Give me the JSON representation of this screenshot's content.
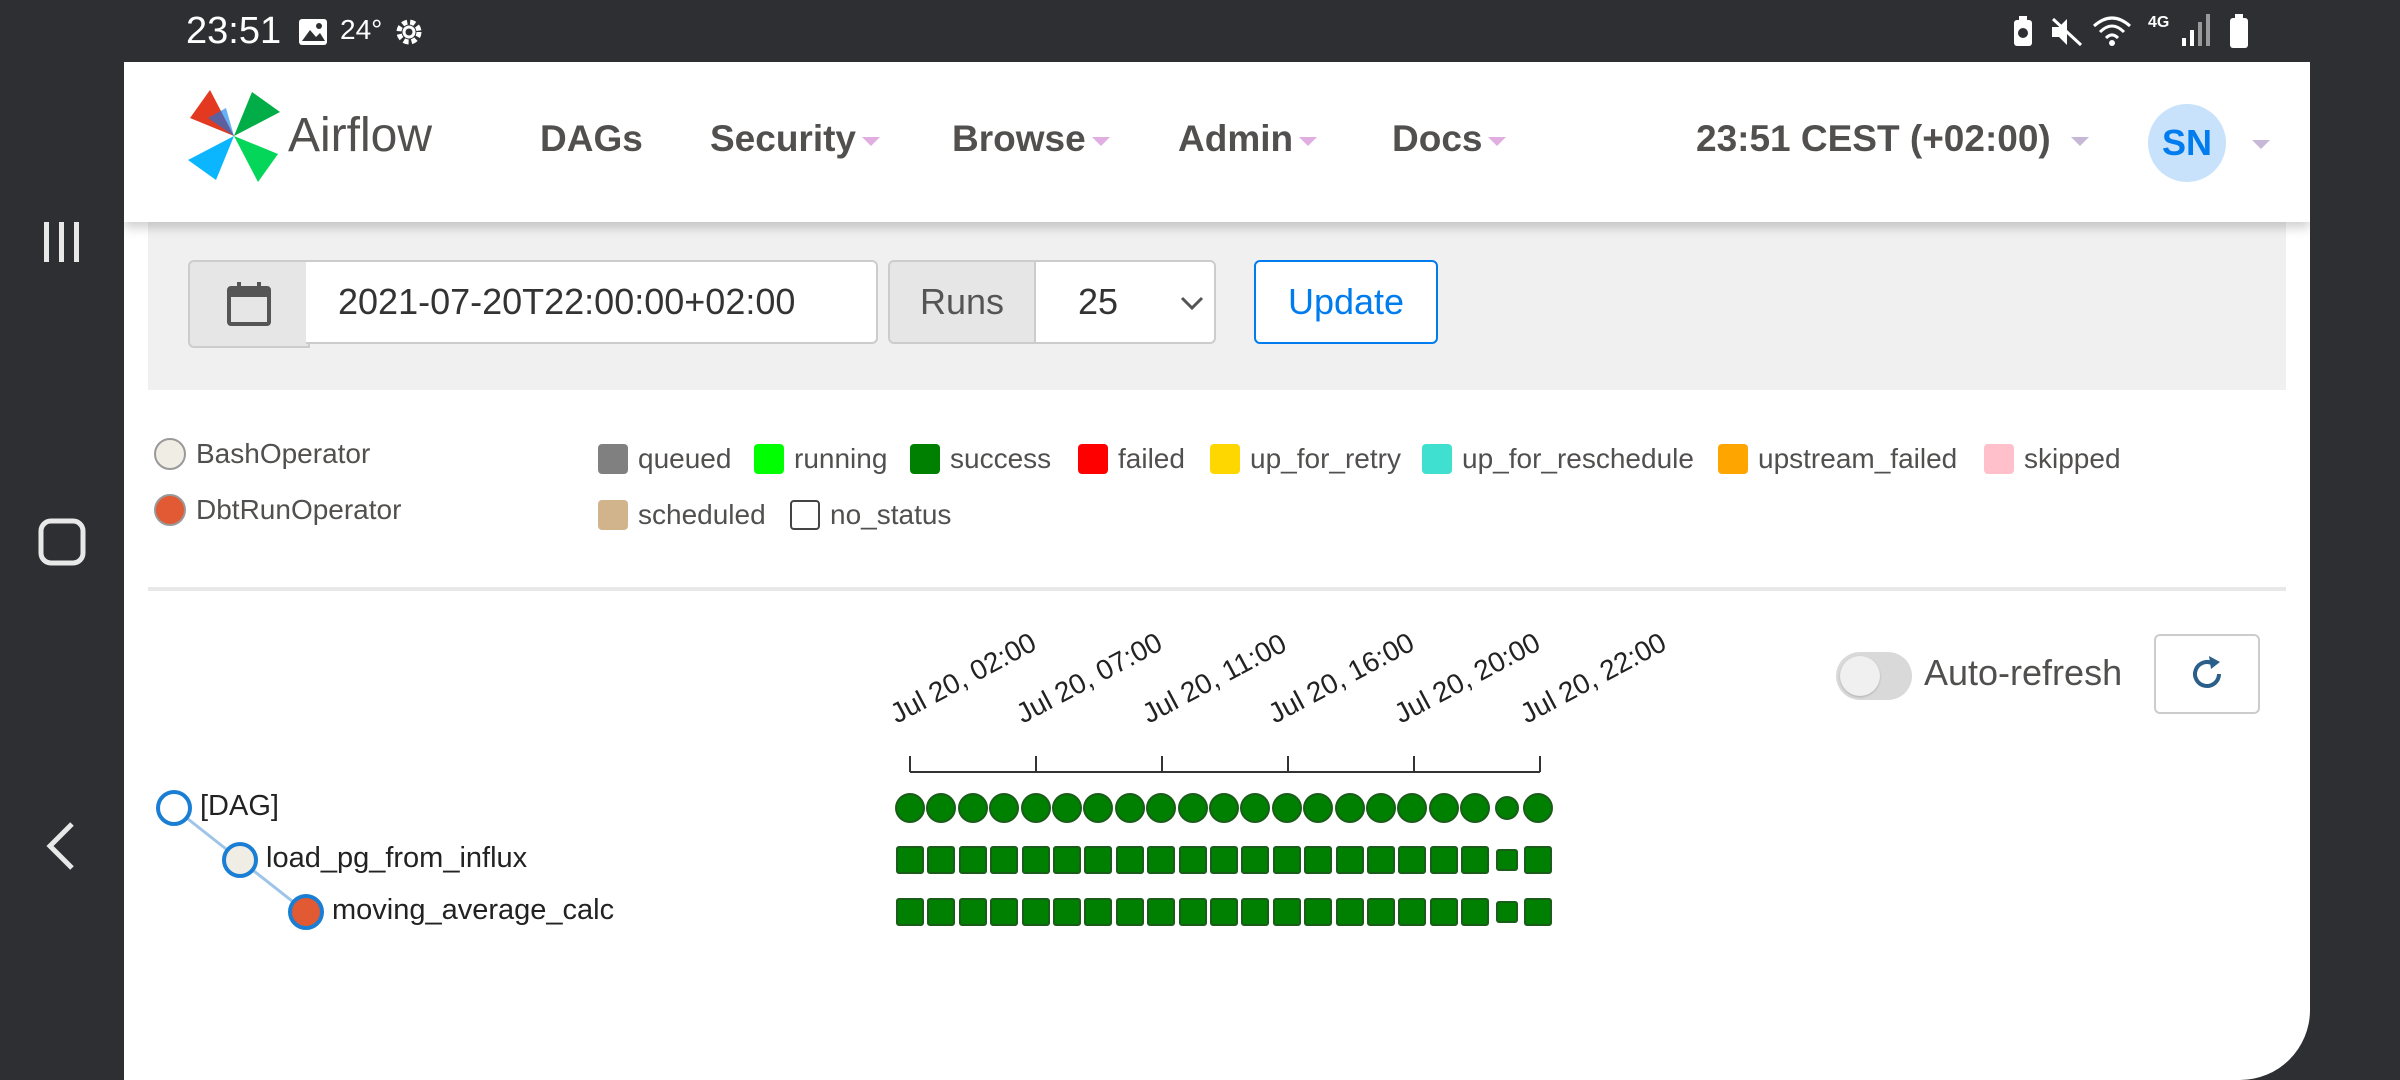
{
  "status_bar": {
    "time": "23:51",
    "temperature": "24°",
    "icons": [
      "image-icon",
      "gear-icon",
      "battery-saver-icon",
      "mute-icon",
      "wifi-icon",
      "network-4g-icon",
      "signal-icon",
      "battery-icon"
    ]
  },
  "android_nav": {
    "icons": [
      "recent-apps-icon",
      "home-icon",
      "back-icon"
    ]
  },
  "header": {
    "app_name": "Airflow",
    "menu": [
      {
        "label": "DAGs",
        "dropdown": false
      },
      {
        "label": "Security",
        "dropdown": true
      },
      {
        "label": "Browse",
        "dropdown": true
      },
      {
        "label": "Admin",
        "dropdown": true
      },
      {
        "label": "Docs",
        "dropdown": true
      }
    ],
    "clock": "23:51 CEST (+02:00)",
    "user_initials": "SN"
  },
  "form": {
    "base_date": "2021-07-20T22:00:00+02:00",
    "runs_label": "Runs",
    "runs_value": "25",
    "update_label": "Update"
  },
  "legend": {
    "operators": [
      {
        "label": "BashOperator",
        "color": "#f0ede4"
      },
      {
        "label": "DbtRunOperator",
        "color": "#e15a33"
      }
    ],
    "states_row1": [
      {
        "label": "queued",
        "color": "#808080"
      },
      {
        "label": "running",
        "color": "#00ff00"
      },
      {
        "label": "success",
        "color": "#008000"
      },
      {
        "label": "failed",
        "color": "#ff0000"
      },
      {
        "label": "up_for_retry",
        "color": "#ffd700"
      },
      {
        "label": "up_for_reschedule",
        "color": "#40e0d0"
      },
      {
        "label": "upstream_failed",
        "color": "#ffa500"
      },
      {
        "label": "skipped",
        "color": "#ffc0cb"
      }
    ],
    "states_row2": [
      {
        "label": "scheduled",
        "color": "#d2b48c"
      },
      {
        "label": "no_status",
        "color": "#ffffff"
      }
    ]
  },
  "controls": {
    "auto_refresh_label": "Auto-refresh",
    "auto_refresh_on": false
  },
  "tree": {
    "nodes": [
      {
        "label": "[DAG]",
        "depth": 0,
        "color": "#ffffff"
      },
      {
        "label": "load_pg_from_influx",
        "depth": 1,
        "color": "#f0ede4"
      },
      {
        "label": "moving_average_calc",
        "depth": 2,
        "color": "#e15a33"
      }
    ],
    "date_ticks": [
      "Jul 20, 02:00",
      "Jul 20, 07:00",
      "Jul 20, 11:00",
      "Jul 20, 16:00",
      "Jul 20, 20:00",
      "Jul 20, 22:00"
    ],
    "run_count": 21,
    "run_state": "success"
  }
}
